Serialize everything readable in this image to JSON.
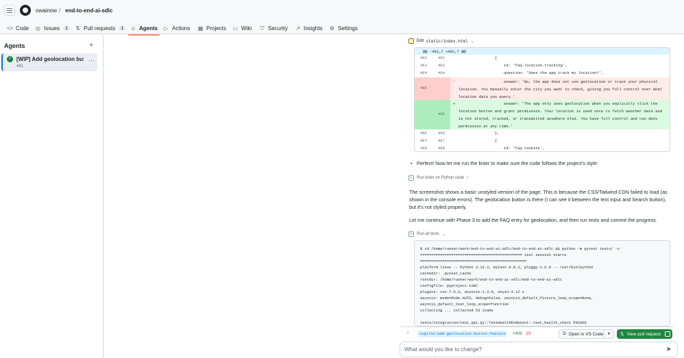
{
  "header": {
    "owner": "owainow",
    "separator": "/",
    "repo": "end-to-end-ai-sdlc",
    "tabs": [
      {
        "label": "Code",
        "icon": "code-icon",
        "count": null,
        "active": false
      },
      {
        "label": "Issues",
        "icon": "issue-icon",
        "count": "1",
        "active": false
      },
      {
        "label": "Pull requests",
        "icon": "pull-request-icon",
        "count": "1",
        "active": false
      },
      {
        "label": "Agents",
        "icon": "agent-icon",
        "count": null,
        "active": true
      },
      {
        "label": "Actions",
        "icon": "play-icon",
        "count": null,
        "active": false
      },
      {
        "label": "Projects",
        "icon": "table-icon",
        "count": null,
        "active": false
      },
      {
        "label": "Wiki",
        "icon": "book-icon",
        "count": null,
        "active": false
      },
      {
        "label": "Security",
        "icon": "shield-icon",
        "count": null,
        "active": false
      },
      {
        "label": "Insights",
        "icon": "graph-icon",
        "count": null,
        "active": false
      },
      {
        "label": "Settings",
        "icon": "gear-icon",
        "count": null,
        "active": false
      }
    ]
  },
  "sidebar": {
    "title": "Agents",
    "add_symbol": "+",
    "item": {
      "title": "[WIP] Add geolocation button",
      "number": "#61",
      "more": "⋯"
    }
  },
  "main": {
    "edit_step": {
      "label": "Edit",
      "path": "static/index.html",
      "chev": "⌄"
    },
    "diff": {
      "hunk": "@@ -462,7 +462,7 @@",
      "lines": [
        {
          "n1": "462",
          "n2": "462",
          "code": "                {"
        },
        {
          "n1": "463",
          "n2": "463",
          "code": "                    id: 'faq-location-tracking',"
        },
        {
          "n1": "464",
          "n2": "464",
          "code": "                    question: 'Does the app track my location?',"
        },
        {
          "n1": "465",
          "n2": "",
          "mark": "-",
          "code": "                    answer: 'No, the app does not use geolocation or track your physical location. You manually enter the city you want to check, giving you full control over what location data you query.'"
        },
        {
          "n1": "",
          "n2": "465",
          "mark": "+",
          "code": "                    answer: 'The app only uses geolocation when you explicitly click the location button and grant permission. Your location is used once to fetch weather data and is not stored, tracked, or transmitted anywhere else. You have full control and can deny permission at any time.'"
        },
        {
          "n1": "466",
          "n2": "466",
          "code": "                },"
        },
        {
          "n1": "467",
          "n2": "467",
          "code": "                {"
        },
        {
          "n1": "468",
          "n2": "468",
          "code": "                    id: 'faq-cookies',"
        }
      ]
    },
    "bullet_text": "Perfect! Now let me run the linter to make sure the code follows the project's style:",
    "lint_step": {
      "label": "Run linter on Python code",
      "chev": "›"
    },
    "paragraph1": "The screenshot shows a basic unstyled version of the page. This is because the CSS/Tailwind CDN failed to load (as shown in the console errors). The geolocation button is there (I can see it between the text input and Search button), but it's not styled properly.",
    "paragraph2": "Let me continue with Phase 3 to add the FAQ entry for geolocation, and then run tests and commit the progress.",
    "tests_step": {
      "label": "Run all tests",
      "chev": "⌄"
    },
    "terminal": "$ cd /home/runner/work/end-to-end-ai-sdlc/end-to-end-ai-sdlc && python -m pytest tests/ -v\n============================================== test session starts\n================================================\nplatform linux -- Python 3.12.3, pytest-9.0.2, pluggy-1.6.0 -- /usr/bin/python\ncachedir: .pytest_cache\nrootdir: /home/runner/work/end-to-end-ai-sdlc/end-to-end-ai-sdlc\nconfigfile: pyproject.toml\nplugins: cov-7.0.0, asyncio-1.3.0, anyio-4.12.1\nasyncio: mode=Mode.AUTO, debug=False, asyncio_default_fixture_loop_scope=None,\nasyncio_default_test_loop_scope=function\ncollecting ... collected 53 items\n\ntests/integration/test_api.py::TestHealthEndpoint::test_health_check PASSED",
    "pr_bar": {
      "expand": "›",
      "branch": "copilot/add-geolocation-button-feature",
      "additions": "+409",
      "deletions": "-23",
      "open_vscode": "Open in VS Code",
      "view_pr": "View pull request"
    },
    "chat": {
      "placeholder": "What would you like to change?",
      "send_icon": "send-icon"
    }
  }
}
